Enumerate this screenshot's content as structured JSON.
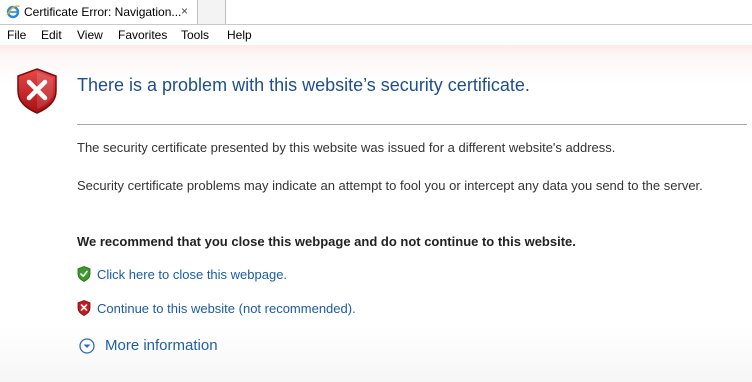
{
  "tab": {
    "title": "Certificate Error: Navigation...",
    "close_glyph": "×",
    "icon": "ie-logo-icon"
  },
  "menu": {
    "items": [
      "File",
      "Edit",
      "View",
      "Favorites",
      "Tools",
      "Help"
    ]
  },
  "page": {
    "title": "There is a problem with this website’s security certificate.",
    "para1": "The security certificate presented by this website was issued for a different website's address.",
    "para2": "Security certificate problems may indicate an attempt to fool you or intercept any data you send to the server.",
    "recommendation": "We recommend that you close this webpage and do not continue to this website.",
    "close_link": "Click here to close this webpage.",
    "continue_link": "Continue to this website (not recommended).",
    "more_info": "More information"
  },
  "colors": {
    "title": "#1f4e8c",
    "link": "#1a5ba8",
    "error_red": "#c8191c",
    "safe_green": "#3a9a2c"
  }
}
